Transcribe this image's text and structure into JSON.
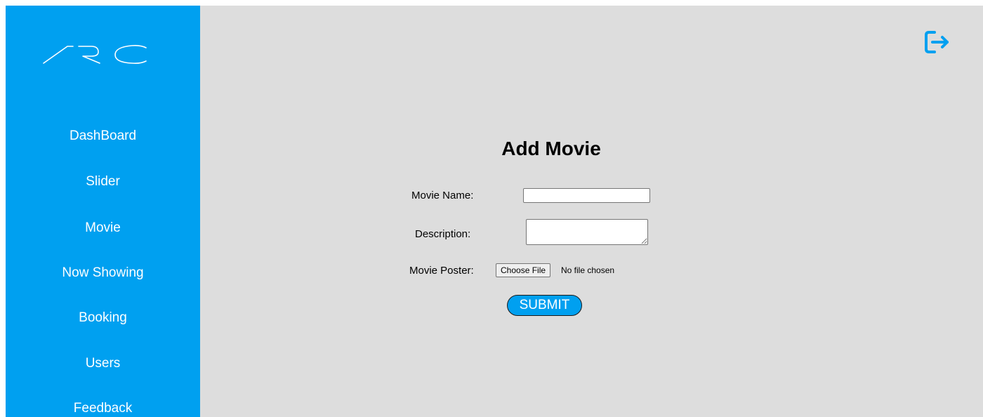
{
  "brand": {
    "logo_text": "ARC",
    "color": "#00a0f0"
  },
  "sidebar": {
    "items": [
      {
        "label": "DashBoard"
      },
      {
        "label": "Slider"
      },
      {
        "label": "Movie"
      },
      {
        "label": "Now Showing"
      },
      {
        "label": "Booking"
      },
      {
        "label": "Users"
      },
      {
        "label": "Feedback"
      }
    ]
  },
  "header": {
    "logout_icon": "logout-icon"
  },
  "form": {
    "title": "Add Movie",
    "movie_name_label": "Movie Name:",
    "movie_name_value": "",
    "description_label": "Description:",
    "description_value": "",
    "poster_label": "Movie Poster:",
    "choose_file_label": "Choose File",
    "file_status": "No file chosen",
    "submit_label": "SUBMIT"
  }
}
